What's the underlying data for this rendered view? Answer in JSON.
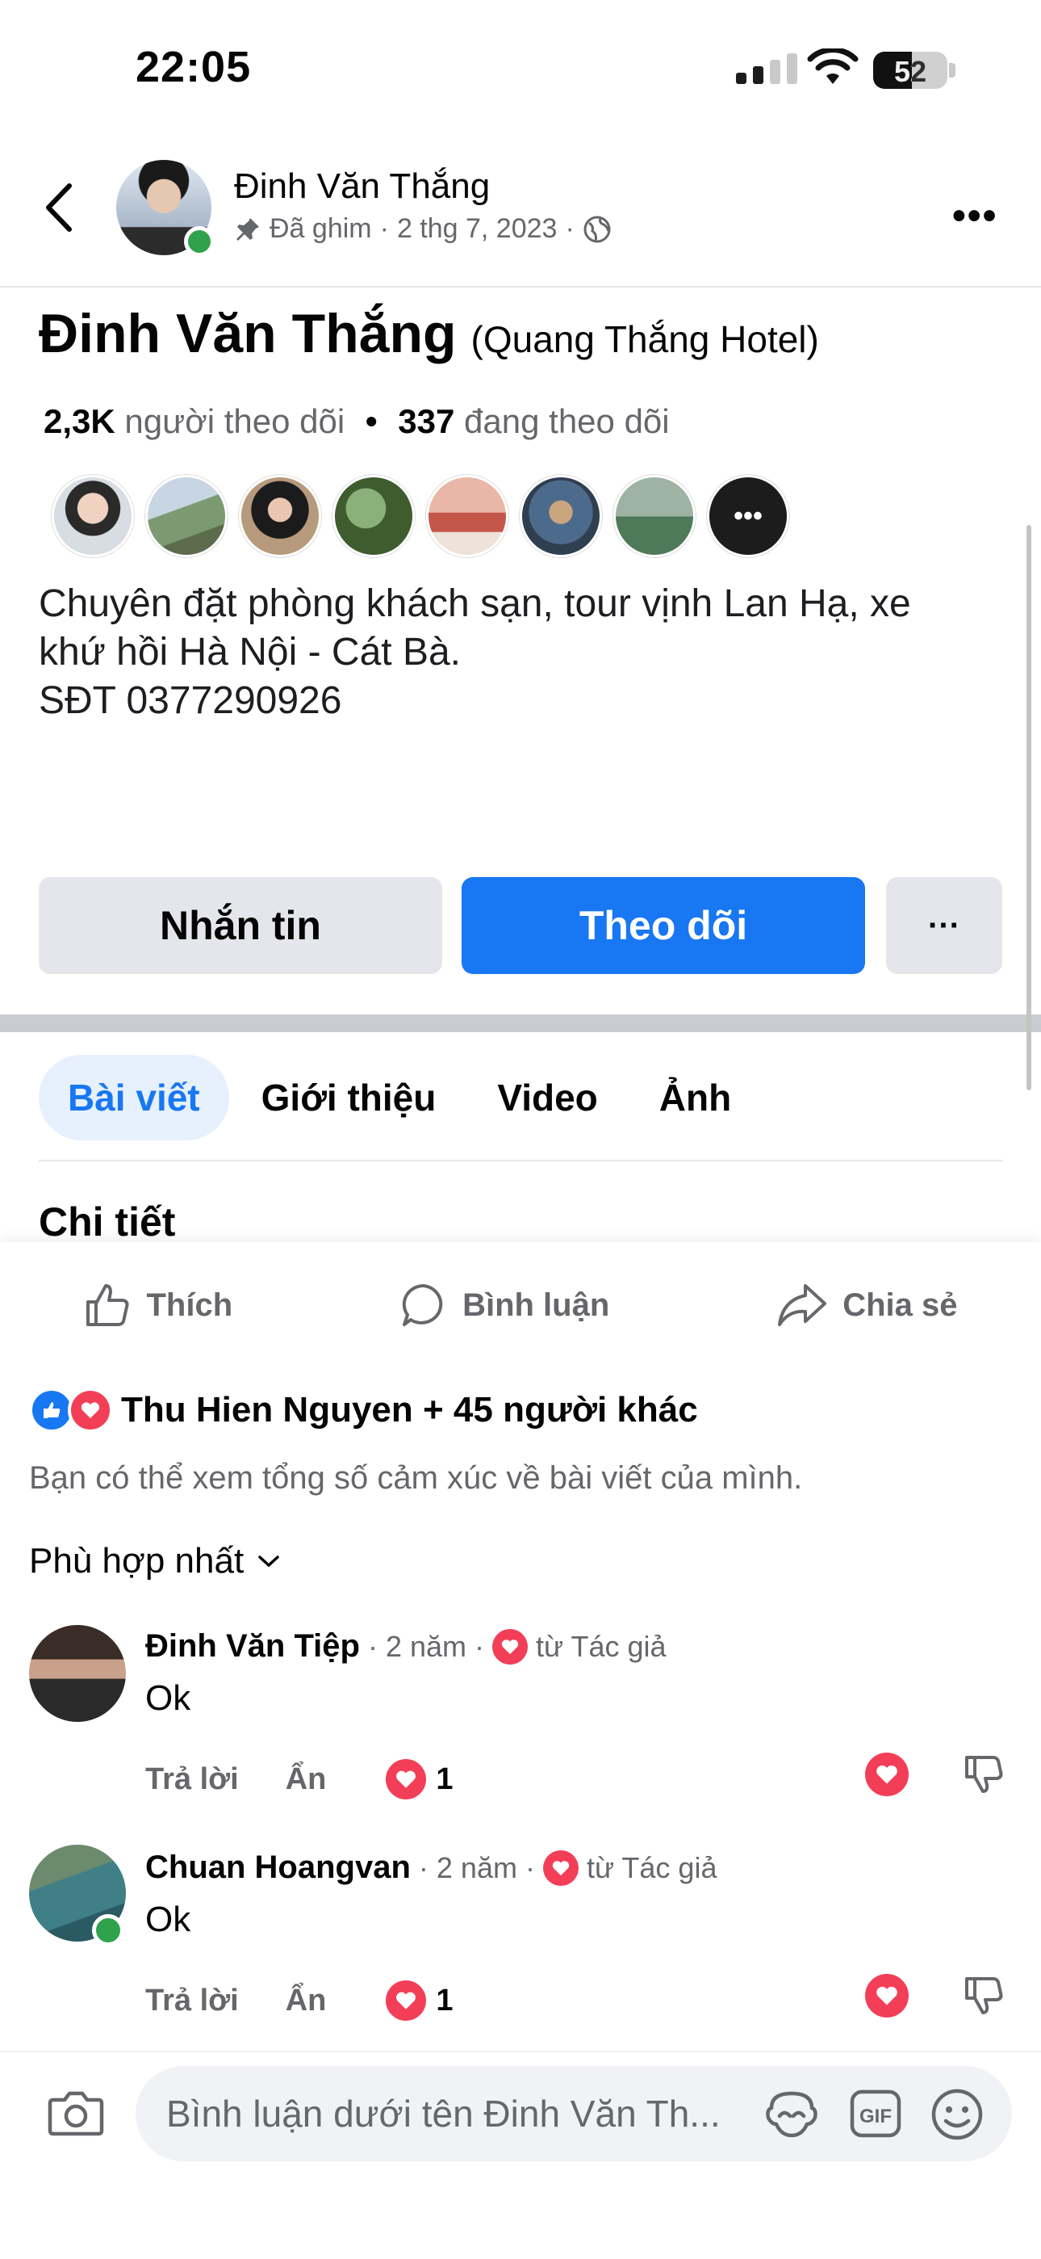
{
  "status": {
    "time": "22:05",
    "battery": "52"
  },
  "header": {
    "name": "Đinh Văn Thắng",
    "pinned": "Đã ghim",
    "date": "2 thg 7, 2023",
    "sep": "·"
  },
  "profile": {
    "name": "Đinh Văn Thắng",
    "subtitle": "(Quang Thắng Hotel)",
    "followers_count": "2,3K",
    "followers_label": "người theo dõi",
    "following_count": "337",
    "following_label": "đang theo dõi",
    "bio": "Chuyên đặt phòng khách sạn, tour vịnh Lan Hạ, xe\nkhứ hồi Hà Nội - Cát Bà.\nSĐT 0377290926",
    "message_label": "Nhắn tin",
    "follow_label": "Theo dõi",
    "more_label": "···"
  },
  "tabs": [
    "Bài viết",
    "Giới thiệu",
    "Video",
    "Ảnh"
  ],
  "section_title": "Chi tiết",
  "post_actions": {
    "like": "Thích",
    "comment": "Bình luận",
    "share": "Chia sẻ"
  },
  "reactions_summary": "Thu Hien Nguyen + 45 người khác",
  "reactions_note": "Bạn có thể xem tổng số cảm xúc về bài viết của mình.",
  "sort_label": "Phù hợp nhất",
  "comments": [
    {
      "author": "Đinh Văn Tiệp",
      "time": "2 năm",
      "from": "từ Tác giả",
      "text": "Ok",
      "reply": "Trả lời",
      "hide": "Ẩn",
      "love_count": "1"
    },
    {
      "author": "Chuan Hoangvan",
      "time": "2 năm",
      "from": "từ Tác giả",
      "text": "Ok",
      "reply": "Trả lời",
      "hide": "Ẩn",
      "love_count": "1"
    }
  ],
  "composer": {
    "placeholder": "Bình luận dưới tên Đinh Văn Th..."
  },
  "colors": {
    "accent": "#1877f2",
    "love": "#f33e58",
    "online": "#31a24c"
  }
}
